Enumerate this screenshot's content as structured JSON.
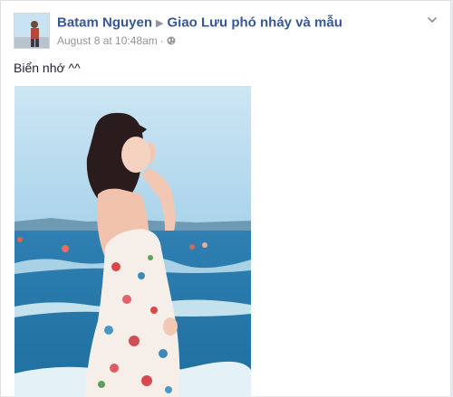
{
  "post": {
    "author": "Batam Nguyen",
    "group": "Giao Lưu phó nháy và mẫu",
    "timestamp": "August 8 at 10:48am",
    "separator": "·",
    "text": "Biển nhớ ^^"
  },
  "icons": {
    "header_arrow": "triangle-right-icon",
    "privacy": "globe-icon",
    "options": "chevron-down-icon"
  },
  "colors": {
    "link": "#365899",
    "meta": "#90949c",
    "text": "#1d2129"
  }
}
